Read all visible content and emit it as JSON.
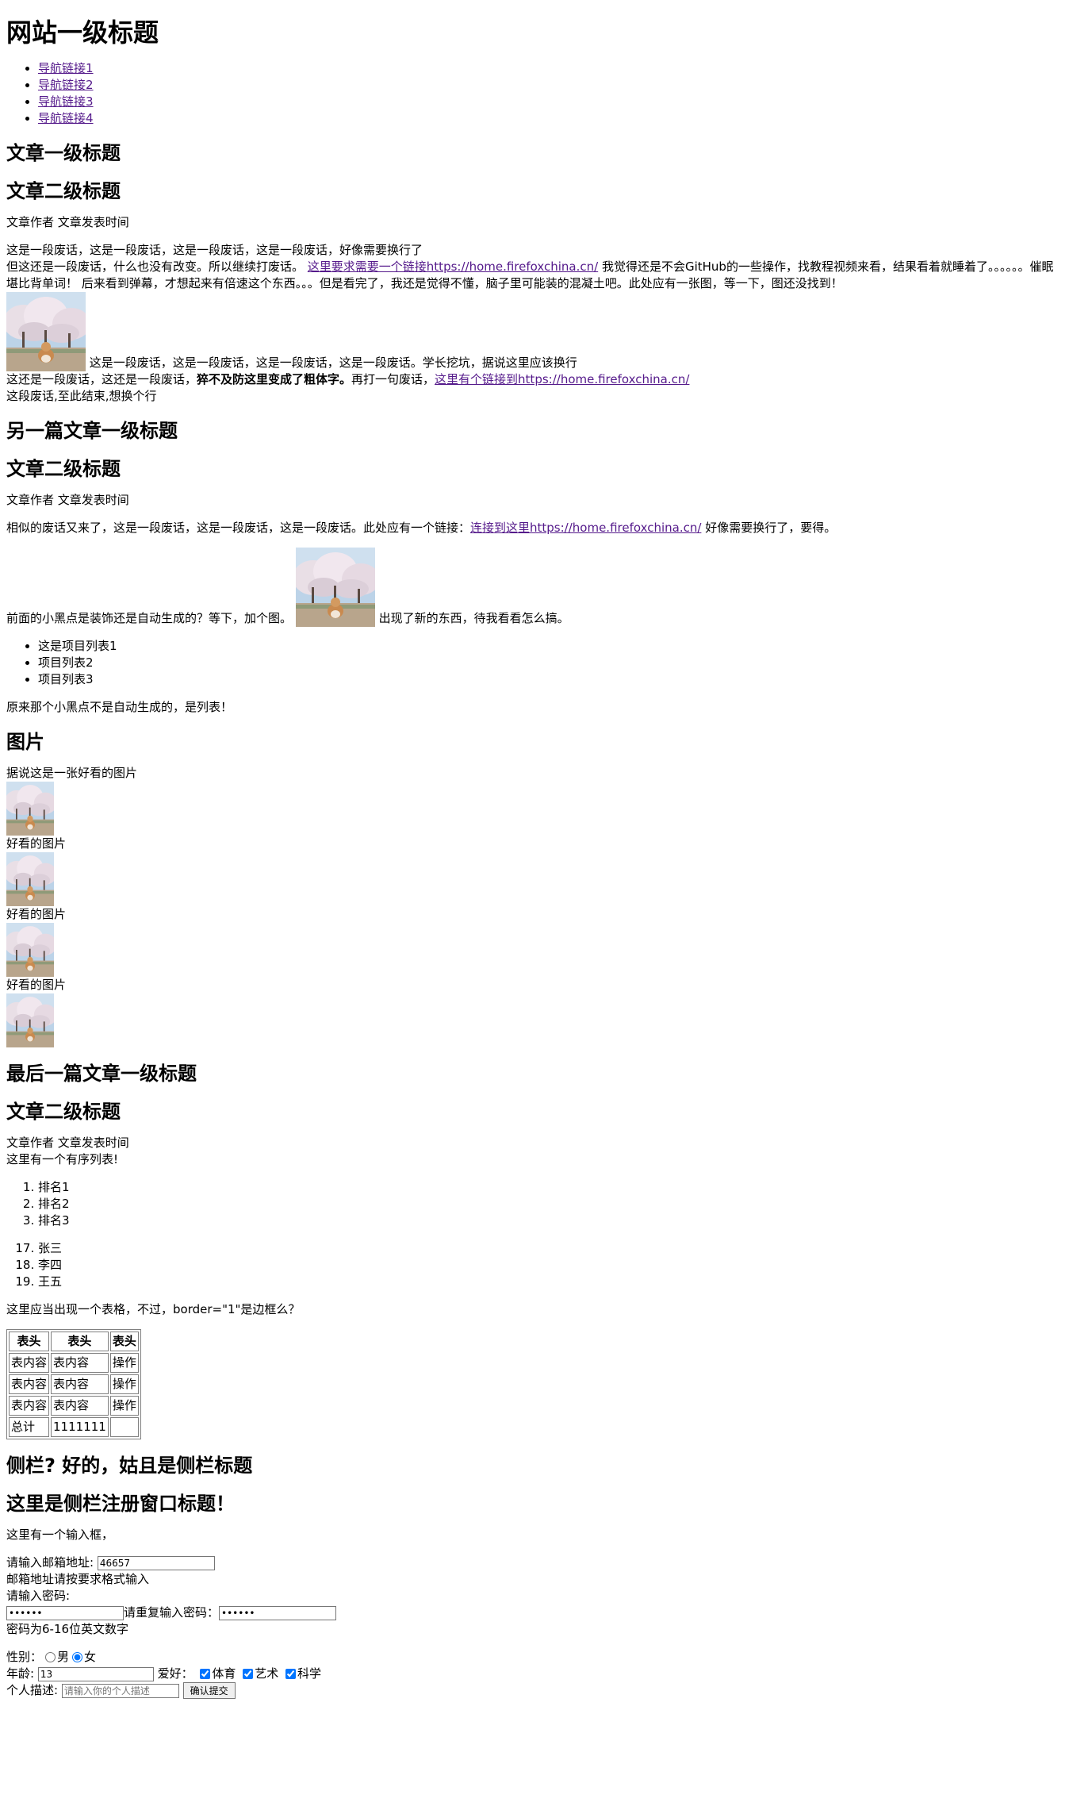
{
  "site_title": "网站一级标题",
  "nav": [
    "导航链接1",
    "导航链接2",
    "导航链接3",
    "导航链接4"
  ],
  "article1": {
    "h1": "文章一级标题",
    "h2": "文章二级标题",
    "meta": "文章作者 文章发表时间",
    "line1": "这是一段废话，这是一段废话，这是一段废话，这是一段废话，好像需要换行了",
    "line2_pre": "但这还是一段废话，什么也没有改变。所以继续打废话。",
    "link1": "这里要求需要一个链接https://home.firefoxchina.cn/",
    "line2_post": "我觉得还是不会GitHub的一些操作，找教程视频来看，结果看着就睡着了。。。。。。催眠堪比背单词！ 后来看到弹幕，才想起来有倍速这个东西。。。但是看完了，我还是觉得不懂，脑子里可能装的混凝土吧。此处应有一张图，等一下，图还没找到！",
    "after_img": "这是一段废话，这是一段废话，这是一段废话，这是一段废话。学长挖坑，据说这里应该换行",
    "line4_pre": "这还是一段废话，这还是一段废话，",
    "line4_bold": "猝不及防这里变成了粗体字。",
    "line4_mid": "再打一句废话，",
    "link2": "这里有个链接到https://home.firefoxchina.cn/",
    "line5": "这段废话,至此结束,想换个行"
  },
  "article2": {
    "h1": "另一篇文章一级标题",
    "h2": "文章二级标题",
    "meta": "文章作者 文章发表时间",
    "p1_pre": "相似的废话又来了，这是一段废话，这是一段废话，这是一段废话。此处应有一个链接：",
    "link": "连接到这里https://home.firefoxchina.cn/",
    "p1_post": "好像需要换行了，要得。",
    "p2_pre": "前面的小黑点是装饰还是自动生成的？等下，加个图。",
    "p2_post": "出现了新的东西，待我看看怎么搞。",
    "list": [
      "这是项目列表1",
      "项目列表2",
      "项目列表3"
    ],
    "p3": "原来那个小黑点不是自动生成的，是列表！"
  },
  "gallery": {
    "h1": "图片",
    "intro": "据说这是一张好看的图片",
    "captions": [
      "好看的图片",
      "好看的图片",
      "好看的图片"
    ]
  },
  "article3": {
    "h1": "最后一篇文章一级标题",
    "h2": "文章二级标题",
    "meta": "文章作者 文章发表时间",
    "ol_intro": "这里有一个有序列表!",
    "ol1": [
      "排名1",
      "排名2",
      "排名3"
    ],
    "ol2": [
      "张三",
      "李四",
      "王五"
    ],
    "table_intro": "这里应当出现一个表格，不过，border=\"1\"是边框么？",
    "table": {
      "headers": [
        "表头",
        "表头",
        "表头"
      ],
      "rows": [
        [
          "表内容",
          "表内容",
          "操作"
        ],
        [
          "表内容",
          "表内容",
          "操作"
        ],
        [
          "表内容",
          "表内容",
          "操作"
        ]
      ],
      "total": [
        "总计",
        "1111111"
      ]
    }
  },
  "sidebar": {
    "h1": "侧栏? 好的，姑且是侧栏标题",
    "h2": "这里是侧栏注册窗口标题！",
    "intro": "这里有一个输入框，",
    "email_label": "请输入邮箱地址:",
    "email_value": "46657",
    "email_hint": "邮箱地址请按要求格式输入",
    "pwd_label": "请输入密码:",
    "pwd_value": "123456",
    "pwd2_label": "请重复输入密码：",
    "pwd2_value": "123456",
    "pwd_hint": "密码为6-16位英文数字",
    "gender_label": "性别：",
    "gender_options": [
      "男",
      "女"
    ],
    "gender_selected": "女",
    "age_label": "年龄:",
    "age_value": "13",
    "hobby_label": "爱好：",
    "hobbies": [
      "体育",
      "艺术",
      "科学"
    ],
    "desc_label": "个人描述:",
    "desc_placeholder": "请输入你的个人描述",
    "submit_label": "确认提交"
  }
}
